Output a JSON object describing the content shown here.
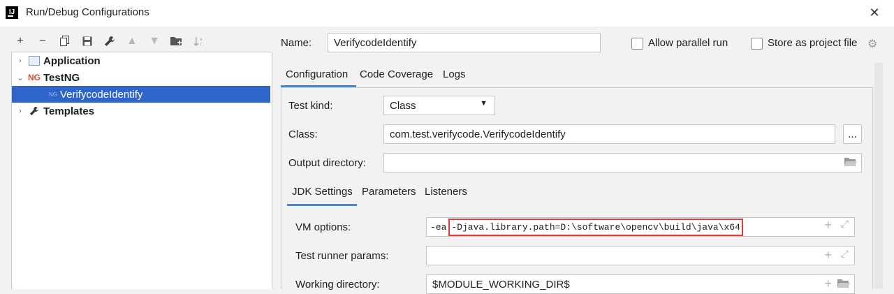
{
  "window": {
    "title": "Run/Debug Configurations",
    "close": "✕"
  },
  "tree": {
    "items": [
      {
        "label": "Application"
      },
      {
        "label": "TestNG"
      },
      {
        "label": "VerifycodeIdentify"
      },
      {
        "label": "Templates"
      }
    ]
  },
  "form": {
    "name_label": "Name:",
    "name_value": "VerifycodeIdentify",
    "allow_parallel": "Allow parallel run",
    "store_project": "Store as project file",
    "tabs": [
      "Configuration",
      "Code Coverage",
      "Logs"
    ],
    "test_kind_label": "Test kind:",
    "test_kind_value": "Class",
    "class_label": "Class:",
    "class_value": "com.test.verifycode.VerifycodeIdentify",
    "browse": "...",
    "output_dir_label": "Output directory:",
    "subtabs": [
      "JDK Settings",
      "Parameters",
      "Listeners"
    ],
    "vm_options_label": "VM options:",
    "vm_prefix": "-ea",
    "vm_value": "-Djava.library.path=D:\\software\\opencv\\build\\java\\x64",
    "test_runner_label": "Test runner params:",
    "working_dir_label": "Working directory:",
    "working_dir_value": "$MODULE_WORKING_DIR$"
  },
  "colors": {
    "selection": "#2f65ca",
    "tab_underline": "#4a86c8",
    "highlight_box": "#e53935"
  }
}
